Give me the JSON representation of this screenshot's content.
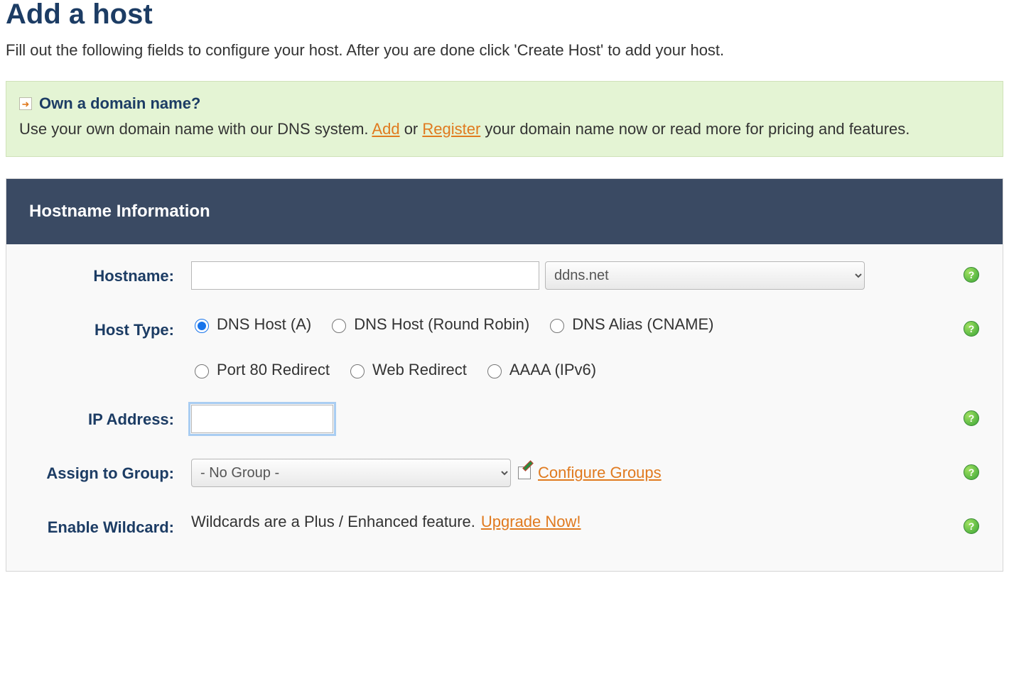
{
  "page": {
    "title": "Add a host",
    "subtitle": "Fill out the following fields to configure your host. After you are done click 'Create Host' to add your host."
  },
  "notice": {
    "title": "Own a domain name?",
    "body_pre": "Use your own domain name with our DNS system. ",
    "link_add": "Add",
    "body_or": " or ",
    "link_register": "Register",
    "body_post": " your domain name now or read more for pricing and features."
  },
  "panel": {
    "header": "Hostname Information"
  },
  "form": {
    "hostname": {
      "label": "Hostname:",
      "value": "",
      "domain_selected": "ddns.net",
      "domain_options": [
        "ddns.net"
      ]
    },
    "host_type": {
      "label": "Host Type:",
      "selected": "dns_host_a",
      "options": {
        "dns_host_a": "DNS Host (A)",
        "dns_host_rr": "DNS Host (Round Robin)",
        "dns_alias_cname": "DNS Alias (CNAME)",
        "port80_redirect": "Port 80 Redirect",
        "web_redirect": "Web Redirect",
        "aaaa_ipv6": "AAAA (IPv6)"
      }
    },
    "ip_address": {
      "label": "IP Address:",
      "value": ""
    },
    "assign_group": {
      "label": "Assign to Group:",
      "selected": "- No Group -",
      "options": [
        "- No Group -"
      ],
      "configure_link": "Configure Groups"
    },
    "enable_wildcard": {
      "label": "Enable Wildcard:",
      "text_pre": "Wildcards are a Plus / Enhanced feature. ",
      "upgrade_link": "Upgrade Now!"
    }
  }
}
